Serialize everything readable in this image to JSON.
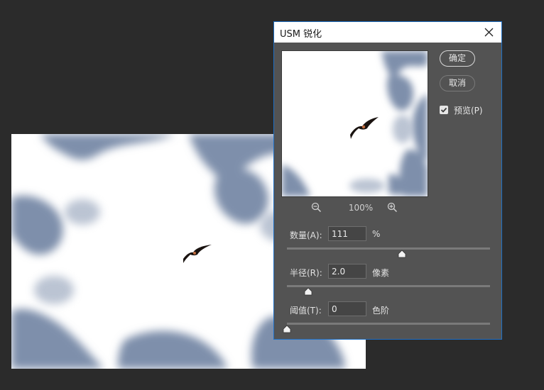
{
  "dialog": {
    "title": "USM 锐化",
    "ok_label": "确定",
    "cancel_label": "取消",
    "preview_checkbox": {
      "label": "预览(P)",
      "checked": true
    },
    "zoom_level": "100%",
    "params": [
      {
        "label": "数量(A):",
        "value": "111",
        "unit": "%",
        "slider_fraction": 0.567
      },
      {
        "label": "半径(R):",
        "value": "2.0",
        "unit": "像素",
        "slider_fraction": 0.105
      },
      {
        "label": "阈值(T):",
        "value": "0",
        "unit": "色阶",
        "slider_fraction": 0.0
      }
    ]
  },
  "icons": {
    "close": "close-icon",
    "zoom_out": "zoom-out-icon",
    "zoom_in": "zoom-in-icon",
    "check": "checkmark-icon"
  },
  "colors": {
    "dialog_bg": "#535353",
    "workspace_bg": "#2b2b2b",
    "sky_blue": "#7e8fab",
    "cloud_white": "#ffffff",
    "dialog_border": "#1f6fc4"
  }
}
